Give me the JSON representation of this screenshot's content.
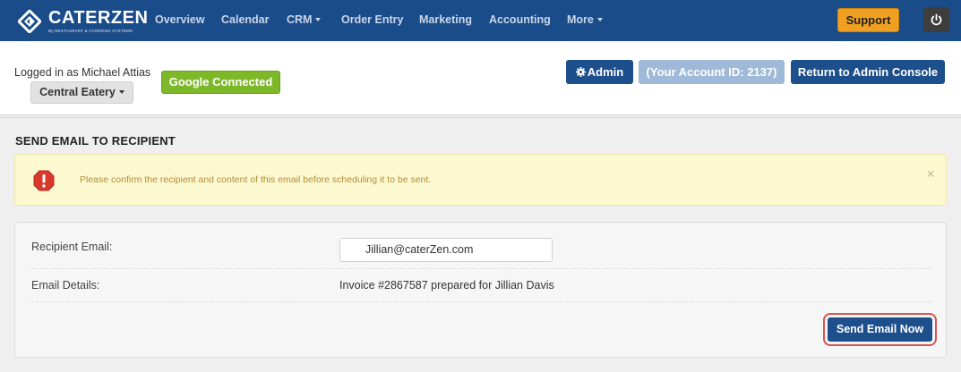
{
  "app": {
    "brand_name": "CATERZEN",
    "brand_tagline": "By RESTAURANT & CATERING SYSTEMS"
  },
  "nav": {
    "items": [
      {
        "label": "Overview",
        "has_caret": false
      },
      {
        "label": "Calendar",
        "has_caret": false
      },
      {
        "label": "CRM",
        "has_caret": true
      },
      {
        "label": "Order Entry",
        "has_caret": false
      },
      {
        "label": "Marketing",
        "has_caret": false
      },
      {
        "label": "Accounting",
        "has_caret": false
      },
      {
        "label": "More",
        "has_caret": true
      }
    ],
    "support_label": "Support",
    "power_icon": "power-icon"
  },
  "header": {
    "logged_in_text": "Logged in as Michael Attias",
    "location_label": "Central Eatery",
    "google_label": "Google Connected",
    "admin_label": "Admin",
    "account_label": "(Your Account ID: 2137)",
    "return_label": "Return to Admin Console"
  },
  "page": {
    "section_title": "SEND EMAIL TO RECIPIENT",
    "alert": {
      "icon": "warning-octagon-icon",
      "message": "Please confirm the recipient and content of this email before scheduling it to be sent.",
      "close_symbol": "×"
    },
    "form": {
      "recipient_label": "Recipient Email:",
      "recipient_value": "Jillian@caterZen.com",
      "details_label": "Email Details:",
      "details_value": "Invoice #2867587 prepared for Jillian Davis",
      "send_label": "Send Email Now"
    }
  },
  "colors": {
    "navbar": "#1b4c8a",
    "primary_button": "#1d4f8c",
    "support_button": "#f0a020",
    "google_button": "#7cb828",
    "alert_background": "#fcf8cf",
    "highlight_ring": "#d9534f"
  }
}
